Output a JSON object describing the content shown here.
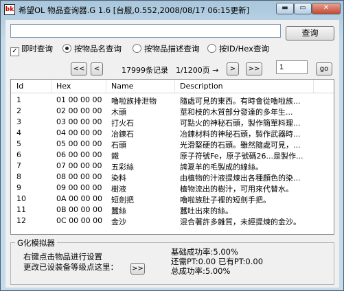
{
  "window": {
    "title": "希望OL 物品查询器.G 1.6 [台服,0.552,2008/08/17 06:15更新]",
    "icon_label": "bk",
    "minimize_glyph": "▬",
    "maximize_glyph": "▭",
    "close_glyph": "✕"
  },
  "search": {
    "value": "",
    "button_label": "查询"
  },
  "options": {
    "instant": {
      "label": "即时查询",
      "checked": true
    },
    "by_name": {
      "label": "按物品名查询",
      "selected": true
    },
    "by_desc": {
      "label": "按物品描述查询",
      "selected": false
    },
    "by_id": {
      "label": "按ID/Hex查询",
      "selected": false
    }
  },
  "pager": {
    "first_label": "<<",
    "prev_label": "<",
    "count_text": "17999条记录",
    "page_text": "1/1200页 →",
    "next_label": ">",
    "last_label": ">>",
    "page_value": "1",
    "go_label": "go"
  },
  "list": {
    "columns": {
      "id": "Id",
      "hex": "Hex",
      "name": "Name",
      "desc": "Description"
    },
    "rows": [
      {
        "id": "1",
        "hex": "01 00 00 00",
        "name": "嚕啦族排泄物",
        "desc": "隨處可見的東西。有時會從嚕啦族..."
      },
      {
        "id": "2",
        "hex": "02 00 00 00",
        "name": "木頭",
        "desc": "莖和枝的木質部分發達的多年生..."
      },
      {
        "id": "3",
        "hex": "03 00 00 00",
        "name": "打火石",
        "desc": "可點火的神秘石頭，製作簡單料理..."
      },
      {
        "id": "4",
        "hex": "04 00 00 00",
        "name": "冶鍊石",
        "desc": "冶鍊材料的神秘石頭，製作武器時..."
      },
      {
        "id": "5",
        "hex": "05 00 00 00",
        "name": "石頭",
        "desc": "光滑堅硬的石頭。雖然隨處可見，..."
      },
      {
        "id": "6",
        "hex": "06 00 00 00",
        "name": "鐵",
        "desc": "原子符號Fe，原子號碼26...是製作..."
      },
      {
        "id": "7",
        "hex": "07 00 00 00",
        "name": "五彩絲",
        "desc": "誇夏羊的毛製成的線絲。"
      },
      {
        "id": "8",
        "hex": "08 00 00 00",
        "name": "染料",
        "desc": "由植物的汁液提煉出各種顏色的染..."
      },
      {
        "id": "9",
        "hex": "09 00 00 00",
        "name": "樹液",
        "desc": "植物流出的樹汁，可用來代替水。"
      },
      {
        "id": "10",
        "hex": "0A 00 00 00",
        "name": "短劍把",
        "desc": "嚕啦族肚子裡的短劍手把。"
      },
      {
        "id": "11",
        "hex": "0B 00 00 00",
        "name": "蠶絲",
        "desc": "蠶吐出來的絲。"
      },
      {
        "id": "12",
        "hex": "0C 00 00 00",
        "name": "金沙",
        "desc": "混合著許多雜質，未經提煉的金沙。"
      }
    ]
  },
  "simulator": {
    "title": "G化模拟器",
    "hint1": "右键点击物品进行设置",
    "hint2": "更改已设装备等级点这里：",
    "arrow_label": ">>",
    "base_rate": "基础成功率:5.00%",
    "bonus_line": "还需PT:0.00   已有PT:0.00",
    "total_rate": "总成功率:5.00%"
  }
}
